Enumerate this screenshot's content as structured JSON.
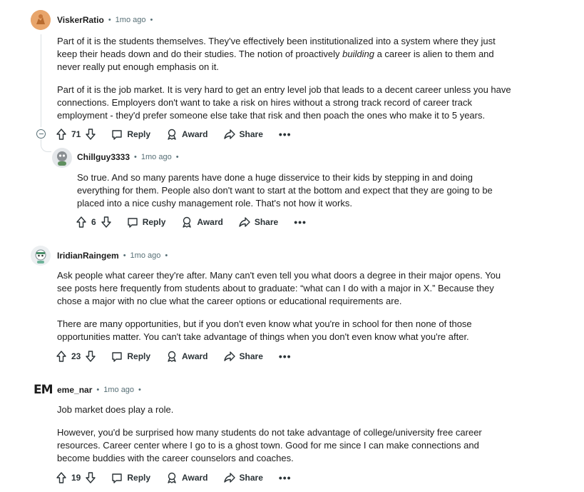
{
  "comments": [
    {
      "user": "ViskerRatio",
      "time": "1mo ago",
      "paragraphs": [
        "Part of it is the students themselves. They've effectively been institutionalized into a system where they just keep their heads down and do their studies. The notion of proactively",
        "building",
        "a career is alien to them and never really put enough emphasis on it.",
        "Part of it is the job market. It is very hard to get an entry level job that leads to a decent career unless you have connections. Employers don't want to take a risk on hires without a strong track record of career track employment - they'd prefer someone else take that risk and then poach the ones who make it to 5 years."
      ],
      "votes": "71"
    },
    {
      "user": "Chillguy3333",
      "time": "1mo ago",
      "paragraphs": [
        "So true. And so many parents have done a huge disservice to their kids by stepping in and doing everything for them. People also don't want to start at the bottom and expect that they are going to be placed into a nice cushy management role. That's not how it works."
      ],
      "votes": "6"
    },
    {
      "user": "IridianRaingem",
      "time": "1mo ago",
      "paragraphs": [
        "Ask people what career they're after. Many can't even tell you what doors a degree in their major opens. You see posts here frequently from students about to graduate: “what can I do with a major in X.” Because they chose a major with no clue what the career options or educational requirements are.",
        "There are many opportunities, but if you don't even know what you're in school for then none of those opportunities matter. You can't take advantage of things when you don't even know what you're after."
      ],
      "votes": "23"
    },
    {
      "user": "eme_nar",
      "time": "1mo ago",
      "avatar_text": "EM",
      "paragraphs": [
        "Job market does play a role.",
        "However, you'd be surprised how many students do not take advantage of college/university free career resources. Career center where I go to is a ghost town. Good for me since I can make connections and become buddies with the career counselors and coaches."
      ],
      "votes": "19"
    }
  ],
  "actions": {
    "reply": "Reply",
    "award": "Award",
    "share": "Share",
    "more": "•••"
  },
  "separator": "•",
  "colors": {
    "meta": "#576f76",
    "thread": "#dbe0e3",
    "text": "#1c1c1c"
  },
  "icons": [
    "upvote-icon",
    "downvote-icon",
    "reply-icon",
    "award-icon",
    "share-icon",
    "more-icon",
    "collapse-icon"
  ]
}
